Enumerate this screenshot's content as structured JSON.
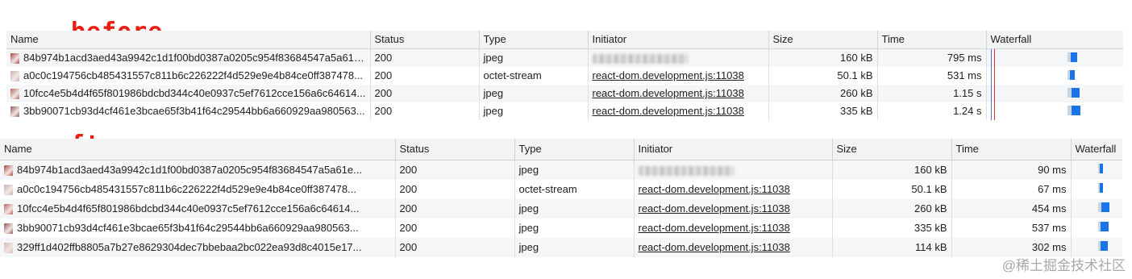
{
  "labels": {
    "before": "before",
    "after": "after"
  },
  "columns": {
    "name": "Name",
    "status": "Status",
    "type": "Type",
    "initiator": "Initiator",
    "size": "Size",
    "time": "Time",
    "waterfall": "Waterfall"
  },
  "before": {
    "rows": [
      {
        "name": "84b974b1acd3aed43a9942c1d1f00bd0387a0205c954f83684547a5a61e...",
        "status": "200",
        "type": "jpeg",
        "initiator": "",
        "initiator_blurred": true,
        "size": "160 kB",
        "time": "795 ms",
        "thumb_color": "#a8463e"
      },
      {
        "name": "a0c0c194756cb485431557c811b6c226222f4d529e9e4b84ce0ff387478...",
        "status": "200",
        "type": "octet-stream",
        "initiator": "react-dom.development.js:11038",
        "initiator_blurred": false,
        "size": "50.1 kB",
        "time": "531 ms",
        "thumb_color": "#c9b2ad"
      },
      {
        "name": "10fcc4e5b4d4f65f801986bdcbd344c40e0937c5ef7612cce156a6c64614...",
        "status": "200",
        "type": "jpeg",
        "initiator": "react-dom.development.js:11038",
        "initiator_blurred": false,
        "size": "260 kB",
        "time": "1.15 s",
        "thumb_color": "#b7645c"
      },
      {
        "name": "3bb90071cb93d4cf461e3bcae65f3b41f64c29544bb6a660929aa980563...",
        "status": "200",
        "type": "jpeg",
        "initiator": "react-dom.development.js:11038",
        "initiator_blurred": false,
        "size": "335 kB",
        "time": "1.24 s",
        "thumb_color": "#8f5a55"
      }
    ]
  },
  "after": {
    "rows": [
      {
        "name": "84b974b1acd3aed43a9942c1d1f00bd0387a0205c954f83684547a5a61e...",
        "status": "200",
        "type": "jpeg",
        "initiator": "",
        "initiator_blurred": true,
        "size": "160 kB",
        "time": "90 ms",
        "thumb_color": "#a8463e"
      },
      {
        "name": "a0c0c194756cb485431557c811b6c226222f4d529e9e4b84ce0ff387478...",
        "status": "200",
        "type": "octet-stream",
        "initiator": "react-dom.development.js:11038",
        "initiator_blurred": false,
        "size": "50.1 kB",
        "time": "67 ms",
        "thumb_color": "#c9b2ad"
      },
      {
        "name": "10fcc4e5b4d4f65f801986bdcbd344c40e0937c5ef7612cce156a6c64614...",
        "status": "200",
        "type": "jpeg",
        "initiator": "react-dom.development.js:11038",
        "initiator_blurred": false,
        "size": "260 kB",
        "time": "454 ms",
        "thumb_color": "#b7645c"
      },
      {
        "name": "3bb90071cb93d4cf461e3bcae65f3b41f64c29544bb6a660929aa980563...",
        "status": "200",
        "type": "jpeg",
        "initiator": "react-dom.development.js:11038",
        "initiator_blurred": false,
        "size": "335 kB",
        "time": "537 ms",
        "thumb_color": "#8f5a55"
      },
      {
        "name": "329ff1d402ffb8805a7b27e8629304dec7bbebaa2bc022ea93d8c4015e17...",
        "status": "200",
        "type": "jpeg",
        "initiator": "react-dom.development.js:11038",
        "initiator_blurred": false,
        "size": "114 kB",
        "time": "302 ms",
        "thumb_color": "#d8b8b2"
      }
    ]
  },
  "watermark": "@稀土掘金技术社区",
  "colors": {
    "label_red": "#ea1d13",
    "waterfall_blue": "#1a73e8",
    "header_bg": "#f1f3f4"
  }
}
